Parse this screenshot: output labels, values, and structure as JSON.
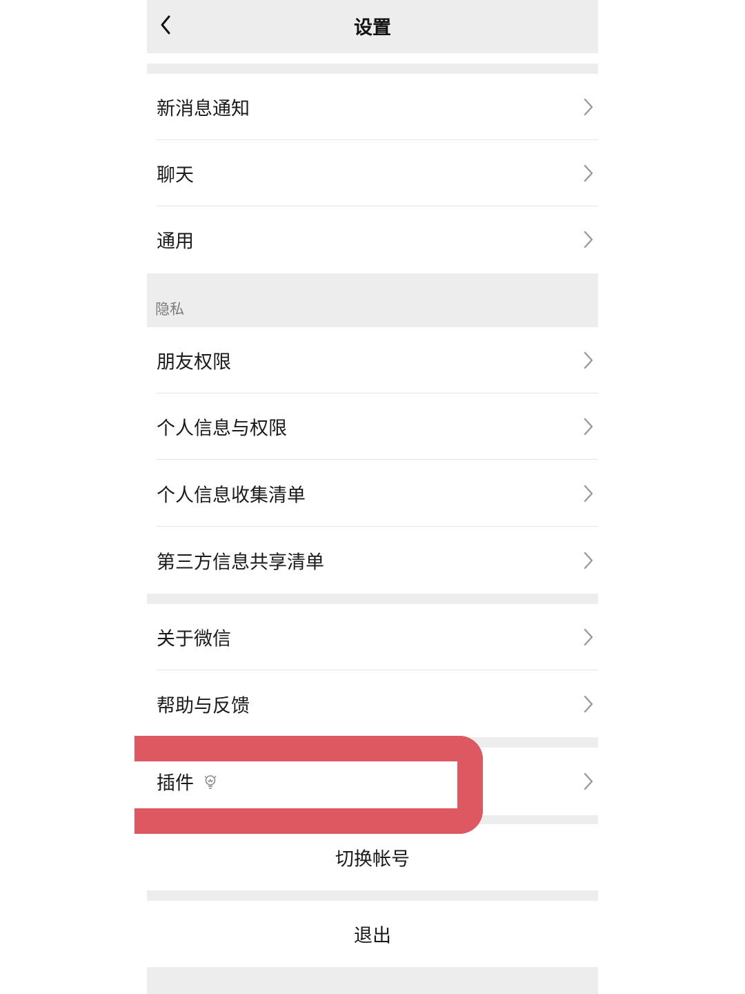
{
  "navbar": {
    "title": "设置",
    "back_icon": "chevron-left-icon"
  },
  "group1": [
    {
      "label": "新消息通知"
    },
    {
      "label": "聊天"
    },
    {
      "label": "通用"
    }
  ],
  "privacy": {
    "header": "隐私",
    "items": [
      {
        "label": "朋友权限"
      },
      {
        "label": "个人信息与权限"
      },
      {
        "label": "个人信息收集清单"
      },
      {
        "label": "第三方信息共享清单"
      }
    ]
  },
  "group3": [
    {
      "label": "关于微信"
    },
    {
      "label": "帮助与反馈"
    }
  ],
  "plugins": {
    "label": "插件",
    "icon": "bulb-icon"
  },
  "switch_account": "切换帐号",
  "logout": "退出",
  "colors": {
    "background": "#ededed",
    "highlight": "#dd5860"
  }
}
